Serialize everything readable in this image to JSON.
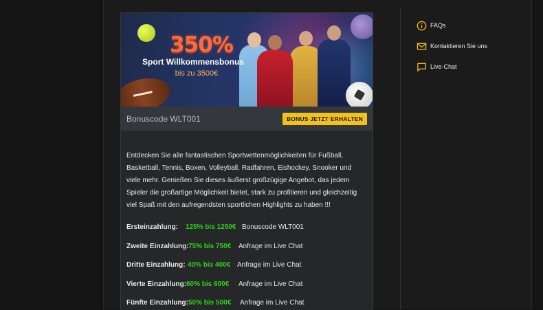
{
  "promo": {
    "percent": "350%",
    "title": "Sport Willkommensbonus",
    "subtitle": "bis zu 3500€"
  },
  "bonus_code_bar": {
    "code_label": "Bonuscode WLT001",
    "button_label": "BONUS JETZT ERHALTEN"
  },
  "description": "Entdecken Sie alle fantastischen Sportwettenmöglichkeiten für Fußball, Basketball, Tennis, Boxen, Volleyball, Radfahren, Eishockey, Snooker und viele mehr. Genießen Sie dieses äußerst großzügige Angebot, das jedem Spieler die großartige Möglichkeit bietet, stark zu profitieren und gleichzeitig viel Spaß mit den aufregendsten sportlichen Highlights zu haben !!!",
  "deposits": [
    {
      "label": "Ersteinzahlung:",
      "amount": "125% bis 1250€",
      "note": "Bonuscode WLT001"
    },
    {
      "label": "Zweite Einzahlung:",
      "amount": "75% bis 750€",
      "note": "Anfrage im Live Chat"
    },
    {
      "label": "Dritte Einzahlung:",
      "amount": "40% bis 400€",
      "note": "Anfrage im Live Chat"
    },
    {
      "label": "Vierte Einzahlung:",
      "amount": "60% bis 600€",
      "note": "Anfrage im Live Chat"
    },
    {
      "label": "Fünfte Einzahlung:",
      "amount": "50% bis 500€",
      "note": "Anfrage im Live Chat"
    }
  ],
  "sidebar": {
    "items": [
      {
        "label": "FAQs",
        "icon": "info-icon"
      },
      {
        "label": "Kontaktieren Sie uns",
        "icon": "mail-icon"
      },
      {
        "label": "Live-Chat",
        "icon": "chat-icon"
      }
    ]
  },
  "colors": {
    "accent": "#f2c21b",
    "bonus_green": "#2dd219",
    "background": "#141414",
    "card": "#262728"
  }
}
